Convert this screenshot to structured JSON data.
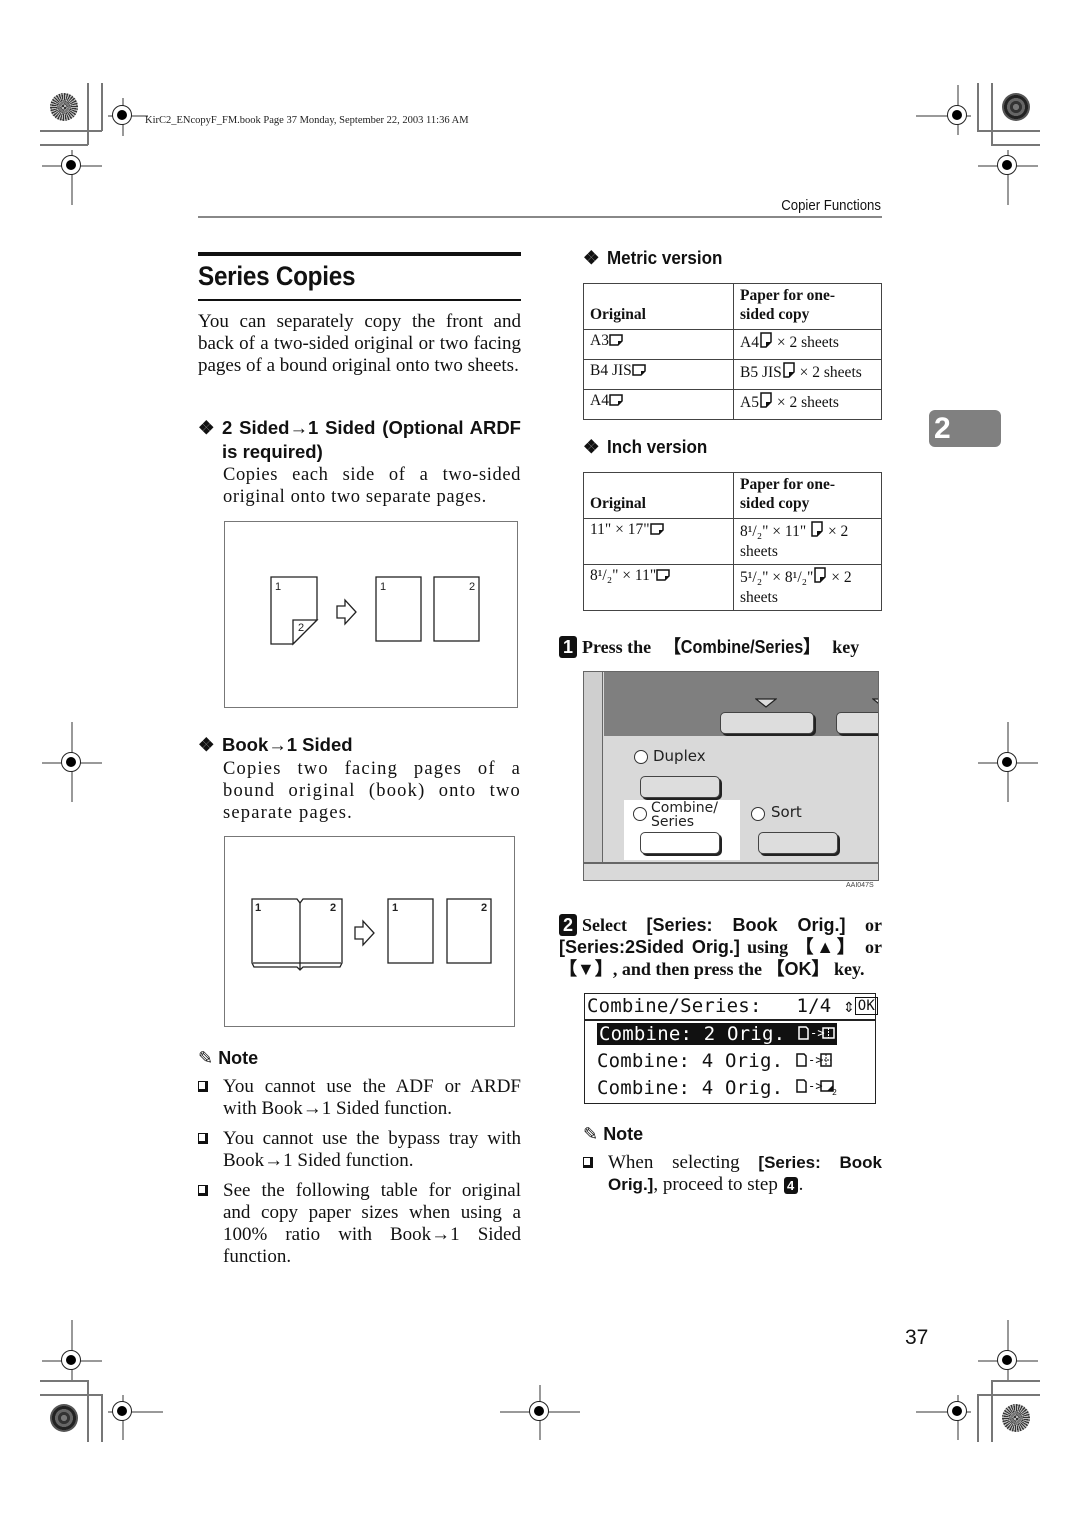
{
  "header": {
    "file_info": "KirC2_ENcopyF_FM.book  Page 37  Monday, September 22, 2003  11:36 AM",
    "running_head": "Copier Functions"
  },
  "chapter_tab": "2",
  "section": {
    "title": "Series Copies",
    "intro": "You can separately copy the front and back of a two-sided original or two facing pages of a bound original onto two sheets."
  },
  "subsections": [
    {
      "bullet": "❖",
      "heading": "2 Sided→1 Sided (Optional ARDF is required)",
      "text": "Copies each side of a two-sided original onto two separate pages.",
      "figure": {
        "source_labels": [
          "1",
          "2"
        ],
        "output_labels": [
          "1",
          "2"
        ]
      }
    },
    {
      "bullet": "❖",
      "heading": "Book→1 Sided",
      "text": "Copies two facing pages of a bound original (book) onto two separate pages.",
      "figure": {
        "source_labels": [
          "1",
          "2"
        ],
        "output_labels": [
          "1",
          "2"
        ]
      }
    }
  ],
  "note_left": {
    "heading": "Note",
    "items": [
      "You cannot use the ADF or ARDF with Book→1 Sided function.",
      "You cannot use the bypass tray with Book→1 Sided function.",
      "See the following table for original and copy paper sizes when using a 100% ratio with Book→1 Sided function."
    ]
  },
  "metric_table": {
    "heading": "Metric version",
    "columns": [
      "Original",
      "Paper for one-sided copy"
    ],
    "rows": [
      [
        "A3",
        "A4",
        "× 2 sheets"
      ],
      [
        "B4 JIS",
        "B5 JIS",
        "× 2 sheets"
      ],
      [
        "A4",
        "A5",
        "× 2 sheets"
      ]
    ]
  },
  "inch_table": {
    "heading": "Inch version",
    "columns": [
      "Original",
      "Paper for one-sided copy"
    ],
    "rows": [
      {
        "original": "11\" × 17\"",
        "copy": "8¹/₂\" × 11\"",
        "suffix": "× 2 sheets"
      },
      {
        "original": "8¹/₂\" × 11\"",
        "copy": "5¹/₂\" × 8¹/₂\"",
        "suffix": "× 2 sheets"
      }
    ]
  },
  "steps": [
    {
      "number": "1",
      "pre": "Press the ",
      "key": "【Combine/Series】",
      "post": " key"
    },
    {
      "number": "2",
      "pre": "Select ",
      "opt1": "[Series: Book Orig.]",
      "mid": " or ",
      "opt2": "[Series:2Sided Orig.]",
      "using": " using ",
      "key_up": "【▲】",
      "or": " or ",
      "key_down": "【▼】",
      "then": ", and then press the ",
      "key_ok": "【OK】",
      "end": " key."
    }
  ],
  "control_panel": {
    "labels": {
      "duplex": "Duplex",
      "combine": "Combine/",
      "combine2": "Series",
      "sort": "Sort"
    },
    "figure_code": "AAI047S"
  },
  "lcd": {
    "title": "Combine/Series:",
    "page": "1/4",
    "arrows": "⇕",
    "ok": "OK",
    "items": [
      {
        "text": "Combine: 2 Orig.",
        "selected": true
      },
      {
        "text": "Combine: 4 Orig.",
        "selected": false
      },
      {
        "text": "Combine: 4 Orig.",
        "selected": false
      }
    ]
  },
  "note_right": {
    "heading": "Note",
    "pre": "When selecting ",
    "option": "[Series: Book Orig.]",
    "post": ", proceed to step ",
    "step": "4",
    "end": "."
  },
  "page_number": "37"
}
